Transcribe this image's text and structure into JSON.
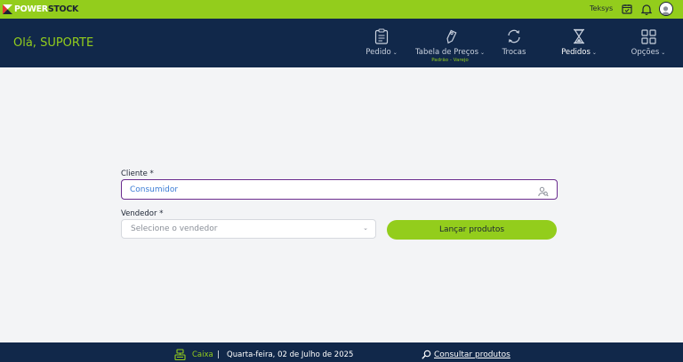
{
  "app": {
    "brand_prefix": "POWER",
    "brand_suffix": "STOCK",
    "company": "Teksys"
  },
  "header": {
    "greeting": "Olá, SUPORTE"
  },
  "nav": [
    {
      "label": "Pedido",
      "icon": "clipboard-icon",
      "dropdown": true
    },
    {
      "label": "Tabela de Preços",
      "icon": "price-tag-icon",
      "dropdown": true,
      "sublabel": "Padrão - Varejo"
    },
    {
      "label": "Trocas",
      "icon": "exchange-icon",
      "dropdown": false
    },
    {
      "label": "Pedidos",
      "icon": "hourglass-icon",
      "dropdown": true
    },
    {
      "label": "Opções",
      "icon": "grid-icon",
      "dropdown": true
    }
  ],
  "form": {
    "client_label": "Cliente *",
    "client_value": "Consumidor",
    "seller_label": "Vendedor *",
    "seller_placeholder": "Selecione o vendedor",
    "launch_button": "Lançar produtos"
  },
  "footer": {
    "caixa": "Caixa",
    "separator": "|",
    "date": "Quarta-feira, 02 de Julho de 2025",
    "consult": "Consultar produtos"
  },
  "colors": {
    "accent": "#93cd1c",
    "navy": "#11284a",
    "focus": "#6b2c8f",
    "link": "#3a7bd5"
  }
}
